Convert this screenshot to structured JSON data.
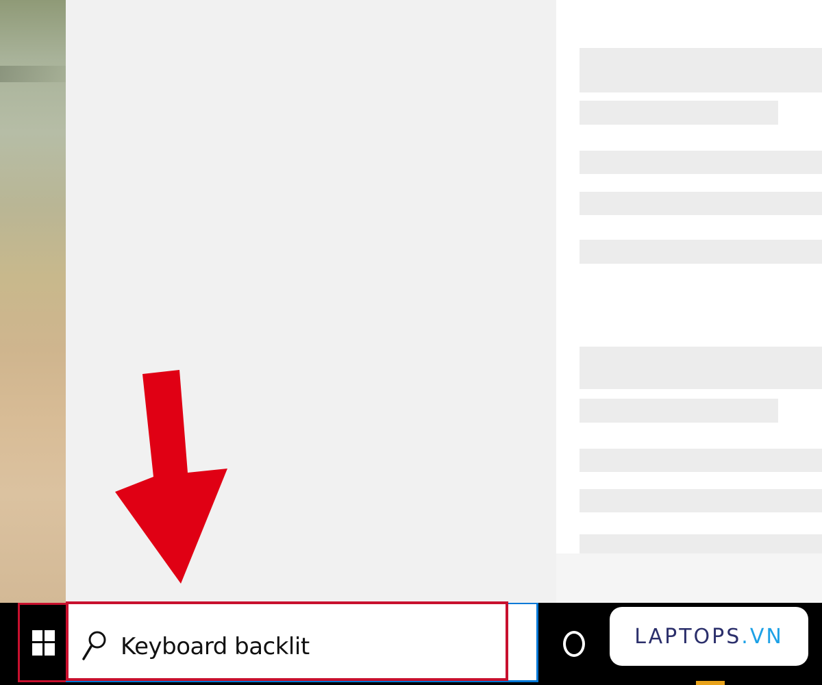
{
  "search": {
    "query": "Keyboard backlit"
  },
  "watermark": {
    "text_main": "LAPTOPS",
    "text_accent": ".VN"
  },
  "colors": {
    "highlight_red": "#c8102e",
    "search_focus_blue": "#0078d7",
    "arrow_red": "#e00014",
    "taskbar": "#000000"
  },
  "icons": {
    "start": "windows-logo-icon",
    "search": "magnifier-icon",
    "cortana": "cortana-circle-icon",
    "annotation": "down-arrow-icon"
  }
}
